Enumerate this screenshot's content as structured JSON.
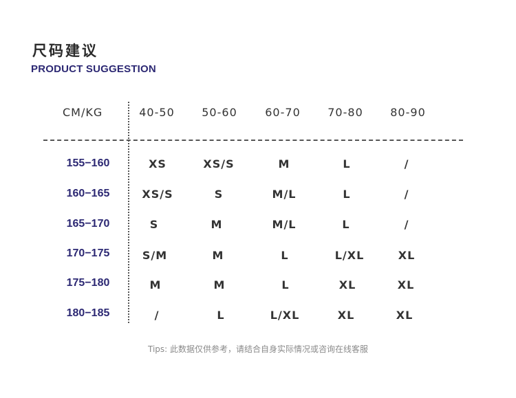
{
  "header": {
    "title_cn": "尺码建议",
    "title_en": "PRODUCT SUGGESTION"
  },
  "table": {
    "corner_label": "CM/KG",
    "columns": [
      "40-50",
      "50-60",
      "60-70",
      "70-80",
      "80-90"
    ],
    "rows": [
      {
        "height": "155−160",
        "sizes": [
          "XS",
          "XS/S",
          "M",
          "L",
          "/"
        ]
      },
      {
        "height": "160−165",
        "sizes": [
          "XS/S",
          "S",
          "M/L",
          "L",
          "/"
        ]
      },
      {
        "height": "165−170",
        "sizes": [
          "S",
          "M",
          "M/L",
          "L",
          "/"
        ]
      },
      {
        "height": "170−175",
        "sizes": [
          "S/M",
          "M",
          "L",
          "L/XL",
          "XL"
        ]
      },
      {
        "height": "175−180",
        "sizes": [
          "M",
          "M",
          "L",
          "XL",
          "XL"
        ]
      },
      {
        "height": "180−185",
        "sizes": [
          "/",
          "L",
          "L/XL",
          "XL",
          "XL"
        ]
      }
    ]
  },
  "tips": "Tips: 此数据仅供参考，请结合自身实际情况或咨询在线客服",
  "colors": {
    "accent": "#2c2873",
    "text": "#333333",
    "muted": "#8a8a8a"
  }
}
